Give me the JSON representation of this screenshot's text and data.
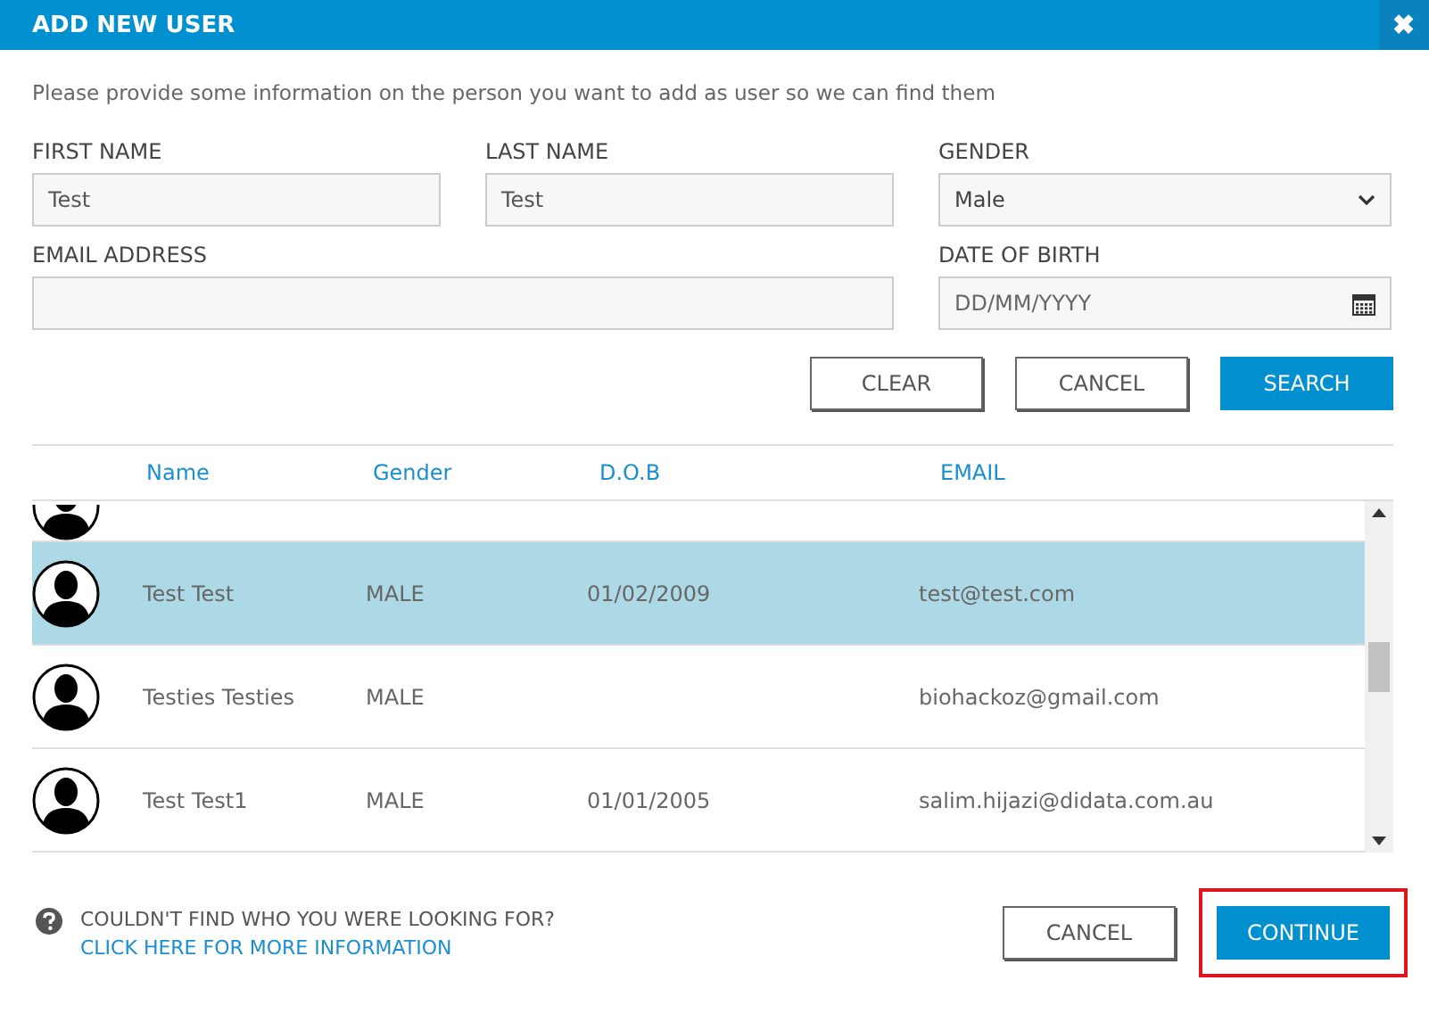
{
  "dialog": {
    "title": "ADD NEW USER",
    "close": "✖"
  },
  "intro": "Please provide some information on the person you want to add as user so we can find them",
  "fields": {
    "first_name": {
      "label": "FIRST NAME",
      "value": "Test"
    },
    "last_name": {
      "label": "LAST NAME",
      "value": "Test"
    },
    "gender": {
      "label": "GENDER",
      "value": "Male"
    },
    "email": {
      "label": "EMAIL ADDRESS"
    },
    "dob": {
      "label": "DATE OF BIRTH",
      "placeholder": "DD/MM/YYYY"
    }
  },
  "search_buttons": [
    {
      "label": "CLEAR",
      "kind": "outline"
    },
    {
      "label": "CANCEL",
      "kind": "outline"
    },
    {
      "label": "SEARCH",
      "kind": "primary"
    }
  ],
  "table": {
    "columns": [
      "Name",
      "Gender",
      "D.O.B",
      "EMAIL"
    ],
    "rows": [
      {
        "name": "Test Test",
        "gender": "MALE",
        "dob": "01/02/2009",
        "email": "test@test.com",
        "selected": true
      },
      {
        "name": "Testies Testies",
        "gender": "MALE",
        "email": "biohackoz@gmail.com",
        "selected": false
      },
      {
        "name": "Test Test1",
        "gender": "MALE",
        "dob": "01/01/2005",
        "email": "salim.hijazi@didata.com.au",
        "selected": false
      }
    ]
  },
  "footer": {
    "question": "COULDN'T FIND WHO YOU WERE LOOKING FOR?",
    "link": "CLICK HERE FOR MORE INFORMATION",
    "buttons": [
      {
        "label": "CANCEL",
        "kind": "outline",
        "highlighted": false
      },
      {
        "label": "CONTINUE",
        "kind": "primary",
        "highlighted": true
      }
    ]
  }
}
